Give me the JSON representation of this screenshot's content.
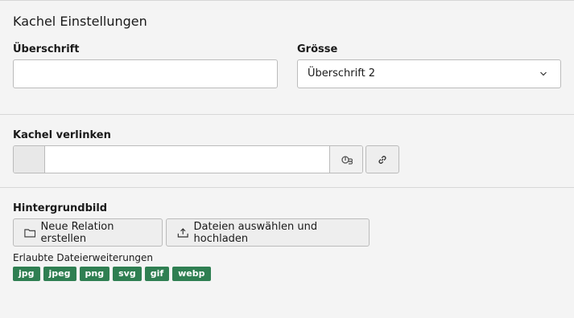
{
  "section": {
    "title": "Kachel Einstellungen"
  },
  "fields": {
    "heading": {
      "label": "Überschrift",
      "value": ""
    },
    "size": {
      "label": "Grösse",
      "selected": "Überschrift 2"
    }
  },
  "link": {
    "label": "Kachel verlinken",
    "value": ""
  },
  "background": {
    "label": "Hintergrundbild",
    "new_relation_label": "Neue Relation erstellen",
    "upload_label": "Dateien auswählen und hochladen",
    "allowed_label": "Erlaubte Dateierweiterungen",
    "extensions": [
      "jpg",
      "jpeg",
      "png",
      "svg",
      "gif",
      "webp"
    ]
  },
  "icons": {
    "select_chevron": "chevron-down-icon",
    "link_wizard": "link-wizard-icon",
    "link": "link-icon",
    "folder": "folder-icon",
    "upload": "upload-icon"
  },
  "colors": {
    "badge": "#2f7f52"
  }
}
